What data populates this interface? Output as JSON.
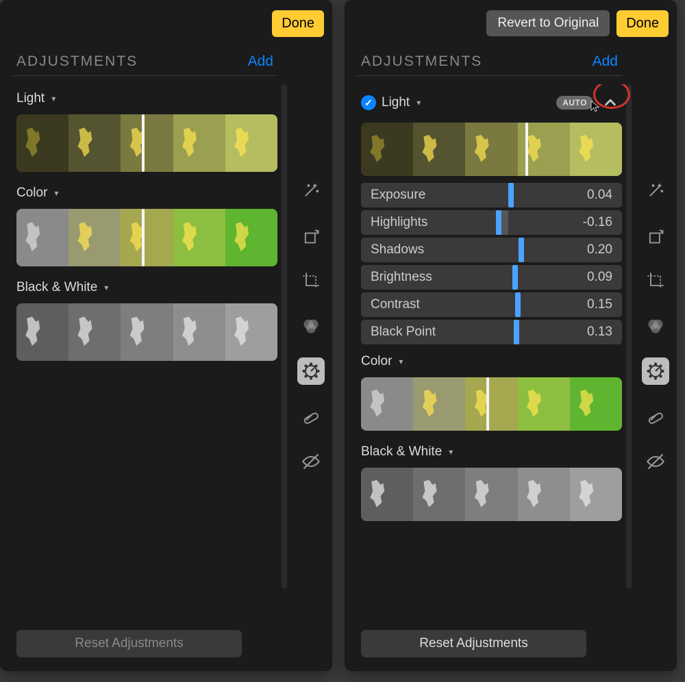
{
  "left": {
    "done": "Done",
    "title": "ADJUSTMENTS",
    "add": "Add",
    "groups": {
      "light": "Light",
      "color": "Color",
      "bw": "Black & White"
    },
    "reset": "Reset Adjustments"
  },
  "right": {
    "revert": "Revert to Original",
    "done": "Done",
    "title": "ADJUSTMENTS",
    "add": "Add",
    "groups": {
      "light": "Light",
      "color": "Color",
      "bw": "Black & White"
    },
    "auto": "AUTO",
    "sliders": [
      {
        "label": "Exposure",
        "value": "0.04",
        "pos": 0.52
      },
      {
        "label": "Highlights",
        "value": "-0.16",
        "pos": 0.42,
        "fill": true
      },
      {
        "label": "Shadows",
        "value": "0.20",
        "pos": 0.6
      },
      {
        "label": "Brightness",
        "value": "0.09",
        "pos": 0.55
      },
      {
        "label": "Contrast",
        "value": "0.15",
        "pos": 0.57
      },
      {
        "label": "Black Point",
        "value": "0.13",
        "pos": 0.56
      }
    ],
    "reset": "Reset Adjustments"
  }
}
